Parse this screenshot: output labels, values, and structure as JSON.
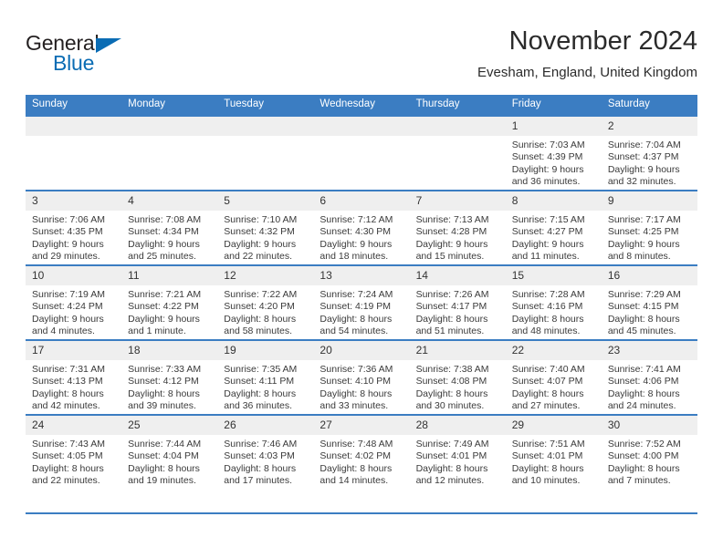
{
  "brand": {
    "word_one": "General",
    "word_two": "Blue",
    "triangle_icon": "triangle-logo-icon",
    "accent_color": "#0a6cb4"
  },
  "header": {
    "month_title": "November 2024",
    "location": "Evesham, England, United Kingdom"
  },
  "theme": {
    "header_blue": "#3b7dc2",
    "daynum_band": "#efefef",
    "text": "#3a3a3a"
  },
  "calendar": {
    "weekday_headers": [
      "Sunday",
      "Monday",
      "Tuesday",
      "Wednesday",
      "Thursday",
      "Friday",
      "Saturday"
    ],
    "weeks": [
      [
        {
          "day": "",
          "sunrise": "",
          "sunset": "",
          "daylight_line1": "",
          "daylight_line2": "",
          "empty": true
        },
        {
          "day": "",
          "sunrise": "",
          "sunset": "",
          "daylight_line1": "",
          "daylight_line2": "",
          "empty": true
        },
        {
          "day": "",
          "sunrise": "",
          "sunset": "",
          "daylight_line1": "",
          "daylight_line2": "",
          "empty": true
        },
        {
          "day": "",
          "sunrise": "",
          "sunset": "",
          "daylight_line1": "",
          "daylight_line2": "",
          "empty": true
        },
        {
          "day": "",
          "sunrise": "",
          "sunset": "",
          "daylight_line1": "",
          "daylight_line2": "",
          "empty": true
        },
        {
          "day": "1",
          "sunrise": "Sunrise: 7:03 AM",
          "sunset": "Sunset: 4:39 PM",
          "daylight_line1": "Daylight: 9 hours",
          "daylight_line2": "and 36 minutes.",
          "empty": false
        },
        {
          "day": "2",
          "sunrise": "Sunrise: 7:04 AM",
          "sunset": "Sunset: 4:37 PM",
          "daylight_line1": "Daylight: 9 hours",
          "daylight_line2": "and 32 minutes.",
          "empty": false
        }
      ],
      [
        {
          "day": "3",
          "sunrise": "Sunrise: 7:06 AM",
          "sunset": "Sunset: 4:35 PM",
          "daylight_line1": "Daylight: 9 hours",
          "daylight_line2": "and 29 minutes.",
          "empty": false
        },
        {
          "day": "4",
          "sunrise": "Sunrise: 7:08 AM",
          "sunset": "Sunset: 4:34 PM",
          "daylight_line1": "Daylight: 9 hours",
          "daylight_line2": "and 25 minutes.",
          "empty": false
        },
        {
          "day": "5",
          "sunrise": "Sunrise: 7:10 AM",
          "sunset": "Sunset: 4:32 PM",
          "daylight_line1": "Daylight: 9 hours",
          "daylight_line2": "and 22 minutes.",
          "empty": false
        },
        {
          "day": "6",
          "sunrise": "Sunrise: 7:12 AM",
          "sunset": "Sunset: 4:30 PM",
          "daylight_line1": "Daylight: 9 hours",
          "daylight_line2": "and 18 minutes.",
          "empty": false
        },
        {
          "day": "7",
          "sunrise": "Sunrise: 7:13 AM",
          "sunset": "Sunset: 4:28 PM",
          "daylight_line1": "Daylight: 9 hours",
          "daylight_line2": "and 15 minutes.",
          "empty": false
        },
        {
          "day": "8",
          "sunrise": "Sunrise: 7:15 AM",
          "sunset": "Sunset: 4:27 PM",
          "daylight_line1": "Daylight: 9 hours",
          "daylight_line2": "and 11 minutes.",
          "empty": false
        },
        {
          "day": "9",
          "sunrise": "Sunrise: 7:17 AM",
          "sunset": "Sunset: 4:25 PM",
          "daylight_line1": "Daylight: 9 hours",
          "daylight_line2": "and 8 minutes.",
          "empty": false
        }
      ],
      [
        {
          "day": "10",
          "sunrise": "Sunrise: 7:19 AM",
          "sunset": "Sunset: 4:24 PM",
          "daylight_line1": "Daylight: 9 hours",
          "daylight_line2": "and 4 minutes.",
          "empty": false
        },
        {
          "day": "11",
          "sunrise": "Sunrise: 7:21 AM",
          "sunset": "Sunset: 4:22 PM",
          "daylight_line1": "Daylight: 9 hours",
          "daylight_line2": "and 1 minute.",
          "empty": false
        },
        {
          "day": "12",
          "sunrise": "Sunrise: 7:22 AM",
          "sunset": "Sunset: 4:20 PM",
          "daylight_line1": "Daylight: 8 hours",
          "daylight_line2": "and 58 minutes.",
          "empty": false
        },
        {
          "day": "13",
          "sunrise": "Sunrise: 7:24 AM",
          "sunset": "Sunset: 4:19 PM",
          "daylight_line1": "Daylight: 8 hours",
          "daylight_line2": "and 54 minutes.",
          "empty": false
        },
        {
          "day": "14",
          "sunrise": "Sunrise: 7:26 AM",
          "sunset": "Sunset: 4:17 PM",
          "daylight_line1": "Daylight: 8 hours",
          "daylight_line2": "and 51 minutes.",
          "empty": false
        },
        {
          "day": "15",
          "sunrise": "Sunrise: 7:28 AM",
          "sunset": "Sunset: 4:16 PM",
          "daylight_line1": "Daylight: 8 hours",
          "daylight_line2": "and 48 minutes.",
          "empty": false
        },
        {
          "day": "16",
          "sunrise": "Sunrise: 7:29 AM",
          "sunset": "Sunset: 4:15 PM",
          "daylight_line1": "Daylight: 8 hours",
          "daylight_line2": "and 45 minutes.",
          "empty": false
        }
      ],
      [
        {
          "day": "17",
          "sunrise": "Sunrise: 7:31 AM",
          "sunset": "Sunset: 4:13 PM",
          "daylight_line1": "Daylight: 8 hours",
          "daylight_line2": "and 42 minutes.",
          "empty": false
        },
        {
          "day": "18",
          "sunrise": "Sunrise: 7:33 AM",
          "sunset": "Sunset: 4:12 PM",
          "daylight_line1": "Daylight: 8 hours",
          "daylight_line2": "and 39 minutes.",
          "empty": false
        },
        {
          "day": "19",
          "sunrise": "Sunrise: 7:35 AM",
          "sunset": "Sunset: 4:11 PM",
          "daylight_line1": "Daylight: 8 hours",
          "daylight_line2": "and 36 minutes.",
          "empty": false
        },
        {
          "day": "20",
          "sunrise": "Sunrise: 7:36 AM",
          "sunset": "Sunset: 4:10 PM",
          "daylight_line1": "Daylight: 8 hours",
          "daylight_line2": "and 33 minutes.",
          "empty": false
        },
        {
          "day": "21",
          "sunrise": "Sunrise: 7:38 AM",
          "sunset": "Sunset: 4:08 PM",
          "daylight_line1": "Daylight: 8 hours",
          "daylight_line2": "and 30 minutes.",
          "empty": false
        },
        {
          "day": "22",
          "sunrise": "Sunrise: 7:40 AM",
          "sunset": "Sunset: 4:07 PM",
          "daylight_line1": "Daylight: 8 hours",
          "daylight_line2": "and 27 minutes.",
          "empty": false
        },
        {
          "day": "23",
          "sunrise": "Sunrise: 7:41 AM",
          "sunset": "Sunset: 4:06 PM",
          "daylight_line1": "Daylight: 8 hours",
          "daylight_line2": "and 24 minutes.",
          "empty": false
        }
      ],
      [
        {
          "day": "24",
          "sunrise": "Sunrise: 7:43 AM",
          "sunset": "Sunset: 4:05 PM",
          "daylight_line1": "Daylight: 8 hours",
          "daylight_line2": "and 22 minutes.",
          "empty": false
        },
        {
          "day": "25",
          "sunrise": "Sunrise: 7:44 AM",
          "sunset": "Sunset: 4:04 PM",
          "daylight_line1": "Daylight: 8 hours",
          "daylight_line2": "and 19 minutes.",
          "empty": false
        },
        {
          "day": "26",
          "sunrise": "Sunrise: 7:46 AM",
          "sunset": "Sunset: 4:03 PM",
          "daylight_line1": "Daylight: 8 hours",
          "daylight_line2": "and 17 minutes.",
          "empty": false
        },
        {
          "day": "27",
          "sunrise": "Sunrise: 7:48 AM",
          "sunset": "Sunset: 4:02 PM",
          "daylight_line1": "Daylight: 8 hours",
          "daylight_line2": "and 14 minutes.",
          "empty": false
        },
        {
          "day": "28",
          "sunrise": "Sunrise: 7:49 AM",
          "sunset": "Sunset: 4:01 PM",
          "daylight_line1": "Daylight: 8 hours",
          "daylight_line2": "and 12 minutes.",
          "empty": false
        },
        {
          "day": "29",
          "sunrise": "Sunrise: 7:51 AM",
          "sunset": "Sunset: 4:01 PM",
          "daylight_line1": "Daylight: 8 hours",
          "daylight_line2": "and 10 minutes.",
          "empty": false
        },
        {
          "day": "30",
          "sunrise": "Sunrise: 7:52 AM",
          "sunset": "Sunset: 4:00 PM",
          "daylight_line1": "Daylight: 8 hours",
          "daylight_line2": "and 7 minutes.",
          "empty": false
        }
      ]
    ]
  }
}
